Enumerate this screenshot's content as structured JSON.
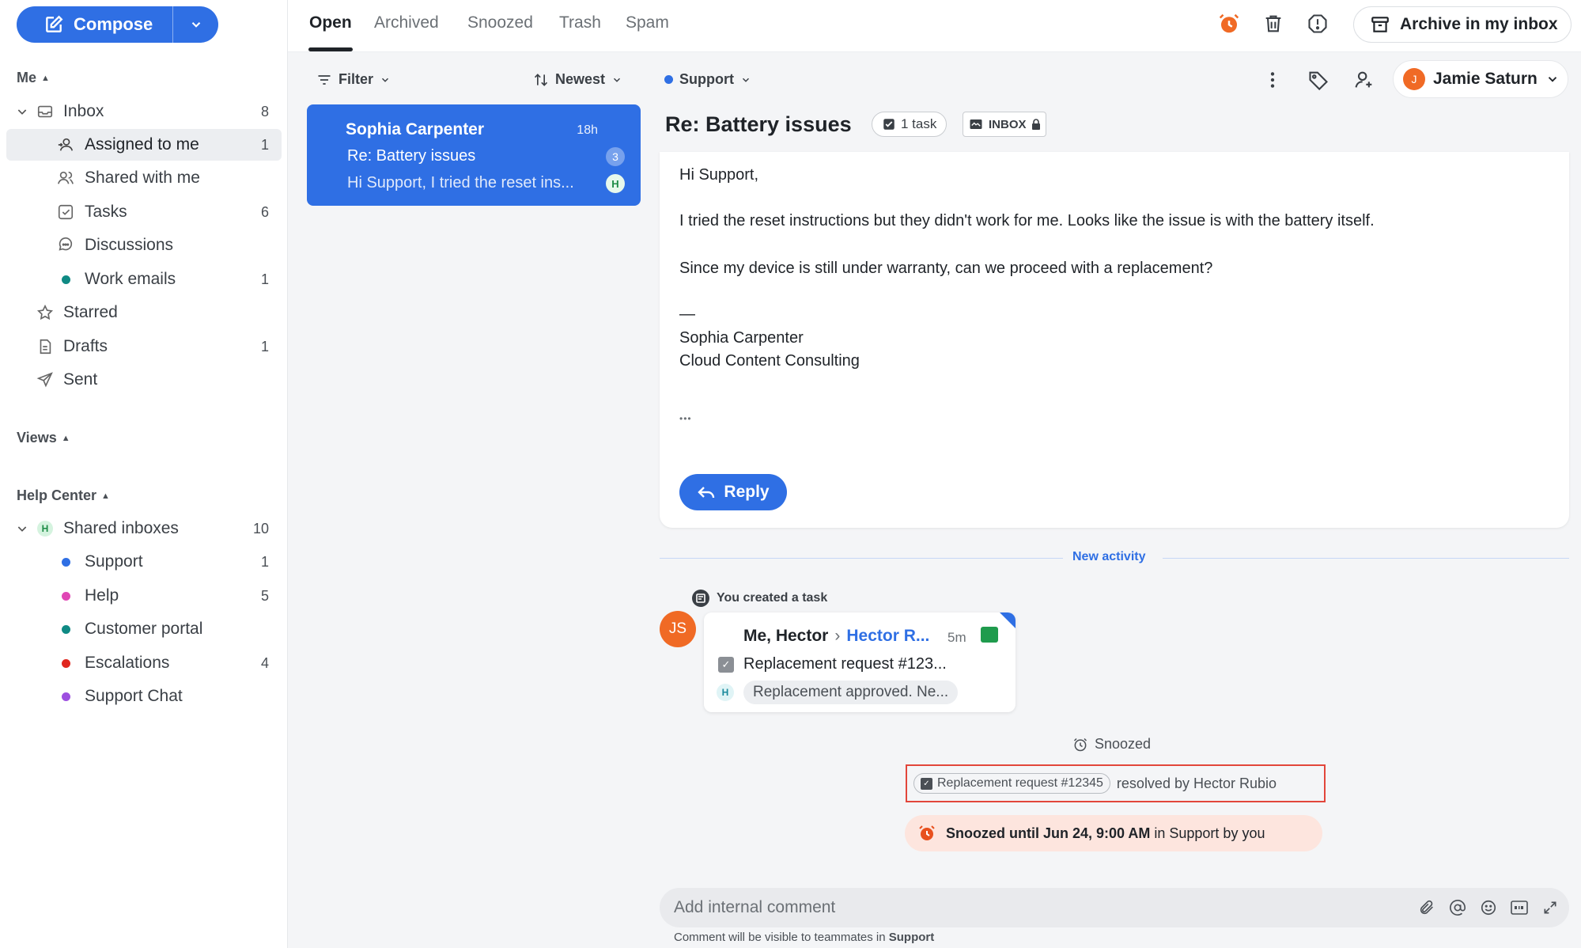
{
  "compose": {
    "label": "Compose"
  },
  "sidebar": {
    "me_header": "Me",
    "inbox": {
      "label": "Inbox",
      "count": "8"
    },
    "me_items": [
      {
        "label": "Assigned to me",
        "count": "1"
      },
      {
        "label": "Shared with me",
        "count": ""
      },
      {
        "label": "Tasks",
        "count": "6"
      },
      {
        "label": "Discussions",
        "count": ""
      },
      {
        "label": "Work emails",
        "count": "1"
      }
    ],
    "starred": {
      "label": "Starred"
    },
    "drafts": {
      "label": "Drafts",
      "count": "1"
    },
    "sent": {
      "label": "Sent"
    },
    "views_header": "Views",
    "help_header": "Help Center",
    "shared_inboxes": {
      "label": "Shared inboxes",
      "count": "10",
      "badge": "H"
    },
    "shared_items": [
      {
        "label": "Support",
        "count": "1",
        "color": "#2f6fe4"
      },
      {
        "label": "Help",
        "count": "5",
        "color": "#e046b5"
      },
      {
        "label": "Customer portal",
        "count": "",
        "color": "#0f8a84"
      },
      {
        "label": "Escalations",
        "count": "4",
        "color": "#e0271f"
      },
      {
        "label": "Support Chat",
        "count": "",
        "color": "#9d4fe0"
      }
    ]
  },
  "tabs": [
    "Open",
    "Archived",
    "Snoozed",
    "Trash",
    "Spam"
  ],
  "toolbar": {
    "archive_label": "Archive in my inbox"
  },
  "list": {
    "filter_label": "Filter",
    "sort_label": "Newest",
    "conversation": {
      "from": "Sophia Carpenter",
      "time": "18h",
      "subject": "Re: Battery issues",
      "count": "3",
      "preview": "Hi Support, I tried the reset ins...",
      "badge": "H"
    }
  },
  "reader": {
    "inbox_selector": "Support",
    "assignee": {
      "initial": "J",
      "name": "Jamie Saturn"
    },
    "subject": "Re: Battery issues",
    "task_pill": "1 task",
    "inbox_pill": "INBOX",
    "message": {
      "greeting": "Hi Support,",
      "para1": "I tried the reset instructions but they didn't work for me. Looks like the issue is with the battery itself.",
      "para2": "Since my device is still under warranty, can we proceed with a replacement?",
      "dash": "—",
      "sig_name": "Sophia Carpenter",
      "sig_company": "Cloud Content Consulting",
      "ellipsis": "•••"
    },
    "reply_label": "Reply",
    "new_activity": "New activity",
    "created_task": "You created a task",
    "task": {
      "avatar": "JS",
      "from": "Me, Hector",
      "to": "Hector R...",
      "time": "5m",
      "title": "Replacement request #123...",
      "badge": "H",
      "snippet": "Replacement approved. Ne..."
    },
    "snoozed_label": "Snoozed",
    "resolved": {
      "task_name": "Replacement request #12345",
      "text": "resolved by Hector Rubio"
    },
    "snooze_banner": {
      "bold": "Snoozed until Jun 24, 9:00 AM",
      "rest": " in Support by you"
    },
    "comment": {
      "placeholder": "Add internal comment",
      "note_prefix": "Comment will be visible to teammates in ",
      "note_inbox": "Support"
    }
  }
}
